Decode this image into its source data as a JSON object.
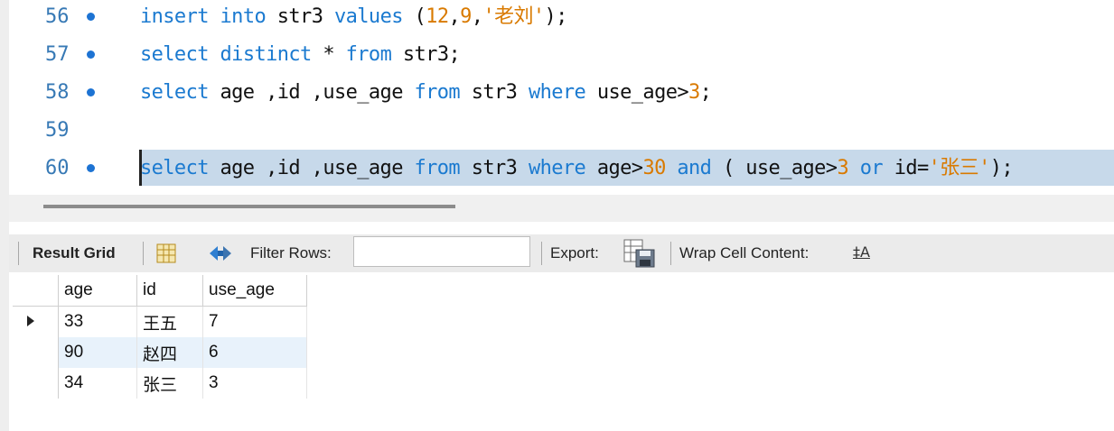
{
  "editor": {
    "lines": [
      {
        "number": "56",
        "has_dot": true,
        "tokens": [
          {
            "t": "insert",
            "c": "kw"
          },
          {
            "t": " "
          },
          {
            "t": "into",
            "c": "kw"
          },
          {
            "t": " str3 "
          },
          {
            "t": "values",
            "c": "kw"
          },
          {
            "t": " ("
          },
          {
            "t": "12",
            "c": "num"
          },
          {
            "t": ","
          },
          {
            "t": "9",
            "c": "num"
          },
          {
            "t": ","
          },
          {
            "t": "'老刘'",
            "c": "str"
          },
          {
            "t": ");"
          }
        ]
      },
      {
        "number": "57",
        "has_dot": true,
        "tokens": [
          {
            "t": "select",
            "c": "kw"
          },
          {
            "t": " "
          },
          {
            "t": "distinct",
            "c": "kw"
          },
          {
            "t": " * "
          },
          {
            "t": "from",
            "c": "kw"
          },
          {
            "t": " str3;"
          }
        ]
      },
      {
        "number": "58",
        "has_dot": true,
        "tokens": [
          {
            "t": "select",
            "c": "kw"
          },
          {
            "t": " age ,id ,use_age "
          },
          {
            "t": "from",
            "c": "kw"
          },
          {
            "t": " str3 "
          },
          {
            "t": "where",
            "c": "kw"
          },
          {
            "t": " use_age>"
          },
          {
            "t": "3",
            "c": "num"
          },
          {
            "t": ";"
          }
        ]
      },
      {
        "number": "59",
        "has_dot": false,
        "tokens": []
      },
      {
        "number": "60",
        "has_dot": true,
        "selected": true,
        "tokens": [
          {
            "t": "select",
            "c": "kw"
          },
          {
            "t": " age ,id ,use_age "
          },
          {
            "t": "from",
            "c": "kw"
          },
          {
            "t": " str3 "
          },
          {
            "t": "where",
            "c": "kw"
          },
          {
            "t": " age>"
          },
          {
            "t": "30",
            "c": "num"
          },
          {
            "t": " "
          },
          {
            "t": "and",
            "c": "kw"
          },
          {
            "t": " ( use_age>"
          },
          {
            "t": "3",
            "c": "num"
          },
          {
            "t": " "
          },
          {
            "t": "or",
            "c": "kw"
          },
          {
            "t": " id="
          },
          {
            "t": "'张三'",
            "c": "str"
          },
          {
            "t": ");"
          }
        ]
      }
    ]
  },
  "toolbar": {
    "result_grid_label": "Result Grid",
    "filter_rows_label": "Filter Rows:",
    "filter_value": "",
    "export_label": "Export:",
    "wrap_label": "Wrap Cell Content:",
    "wrap_icon_text": "‡A"
  },
  "grid": {
    "columns": [
      "age",
      "id",
      "use_age"
    ],
    "rows": [
      [
        "33",
        "王五",
        "7"
      ],
      [
        "90",
        "赵四",
        "6"
      ],
      [
        "34",
        "张三",
        "3"
      ]
    ],
    "current_row": 0
  }
}
